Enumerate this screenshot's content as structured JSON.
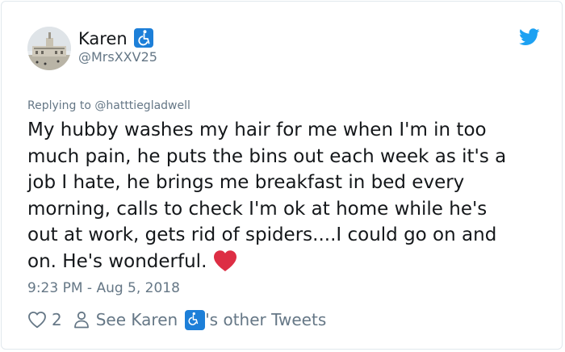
{
  "tweet": {
    "display_name": "Karen",
    "name_emoji": "wheelchair-symbol",
    "handle": "@MrsXXV25",
    "replying_to": "Replying to @hatttiegladwell",
    "text_lines": [
      "My hubby washes my hair for me when I'm in too",
      "much pain, he puts the bins out each week as it's a",
      "job I hate, he brings me breakfast in bed every",
      "morning, calls to check I'm ok at home while he's",
      "out at work, gets rid of spiders....I could go on and",
      "on. He's wonderful."
    ],
    "trailing_emoji": "red-heart",
    "timestamp": "9:23 PM - Aug 5, 2018",
    "like_count": "2",
    "see_other_prefix": "See Karen",
    "see_other_suffix": "'s other Tweets"
  },
  "colors": {
    "twitter_blue": "#1da1f2",
    "secondary_text": "#657786",
    "primary_text": "#14171a",
    "heart_red": "#dd2e44",
    "badge_blue": "#1d7fd8"
  },
  "icons": {
    "brand": "twitter-bird-icon",
    "like": "heart-outline-icon",
    "profile": "person-outline-icon"
  }
}
